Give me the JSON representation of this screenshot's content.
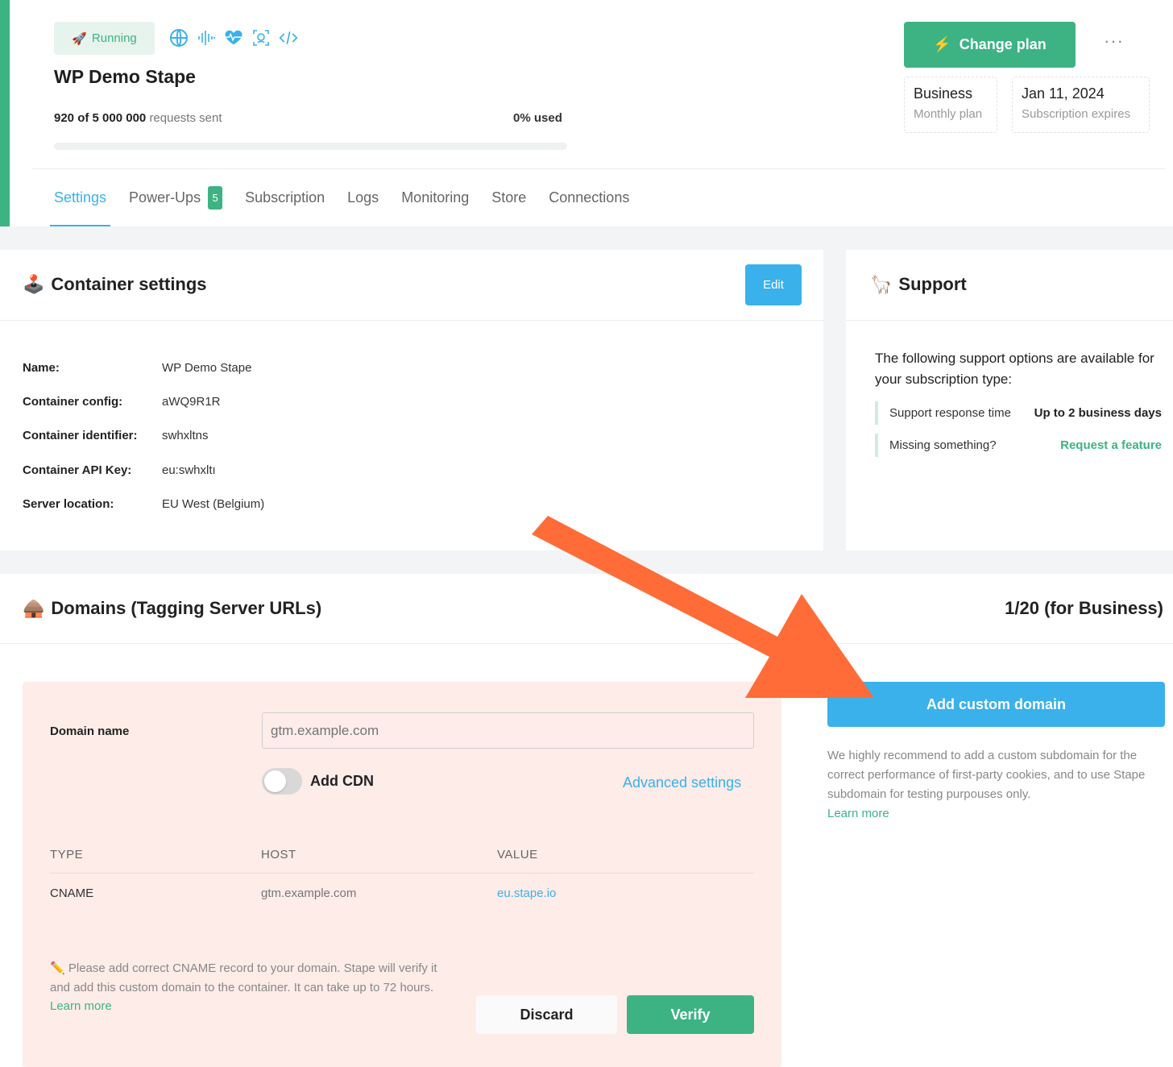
{
  "header": {
    "status": "Running",
    "title": "WP Demo Stape",
    "requests_sent": "920 of 5 000 000",
    "requests_label": "requests sent",
    "usage": "0% used",
    "usage_fraction": 0.0,
    "change_plan_label": "Change plan",
    "more_label": "···",
    "plan": {
      "value": "Business",
      "label": "Monthly plan"
    },
    "expiry": {
      "value": "Jan 11, 2024",
      "label": "Subscription expires"
    },
    "feature_icons": [
      "globe-icon",
      "audio-wave-icon",
      "heartbeat-icon",
      "face-scan-icon",
      "code-icon"
    ]
  },
  "tabs": [
    {
      "label": "Settings",
      "active": true
    },
    {
      "label": "Power-Ups",
      "badge": "5"
    },
    {
      "label": "Subscription"
    },
    {
      "label": "Logs"
    },
    {
      "label": "Monitoring"
    },
    {
      "label": "Store"
    },
    {
      "label": "Connections"
    }
  ],
  "container_settings": {
    "title": "Container settings",
    "edit_label": "Edit",
    "fields": [
      {
        "key": "Name:",
        "value": "WP Demo Stape"
      },
      {
        "key": "Container config:",
        "value": "aWQ9R1R"
      },
      {
        "key": "Container identifier:",
        "value": "swhxltns"
      },
      {
        "key": "Container API Key:",
        "value": "eu:swhxltı"
      },
      {
        "key": "Server location:",
        "value": "EU West (Belgium)"
      }
    ]
  },
  "support": {
    "title": "Support",
    "intro": "The following support options are available for your subscription type:",
    "response_label": "Support response time",
    "response_value": "Up to 2 business days",
    "missing_label": "Missing something?",
    "request_link": "Request a feature"
  },
  "domains": {
    "title": "Domains (Tagging Server URLs)",
    "count": "1/20 (for Business)",
    "form": {
      "domain_label": "Domain name",
      "domain_placeholder": "gtm.example.com",
      "cdn_label": "Add CDN",
      "advanced_label": "Advanced settings",
      "columns": [
        "TYPE",
        "HOST",
        "VALUE"
      ],
      "row": {
        "type": "CNAME",
        "host": "gtm.example.com",
        "value": "eu.stape.io"
      },
      "note": "Please add correct CNAME record to your domain. Stape will verify it and add this custom domain to the container. It can take up to 72 hours.",
      "learn_more": "Learn more",
      "discard_label": "Discard",
      "verify_label": "Verify"
    },
    "add_custom_label": "Add custom domain",
    "recommendation": "We highly recommend to add a custom subdomain for the correct performance of first-party cookies, and to use Stape subdomain for testing purpouses only.",
    "recommendation_link": "Learn more"
  },
  "colors": {
    "green": "#3db384",
    "blue": "#3ab1ea",
    "orange_arrow": "#ff6c37",
    "pink_bg": "#fdece8"
  }
}
